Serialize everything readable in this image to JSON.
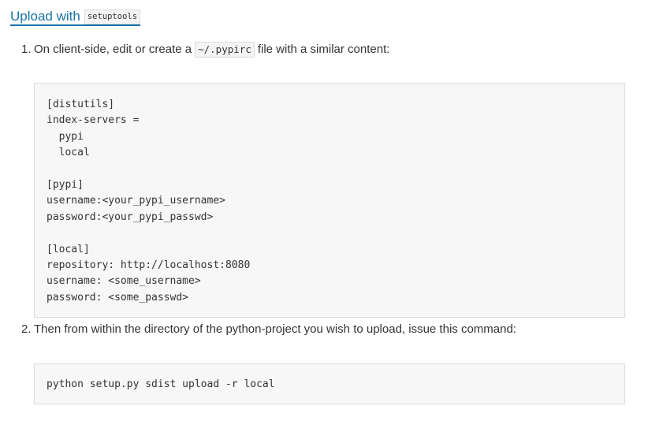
{
  "heading": {
    "link_text": "Upload with",
    "code_text": "setuptools"
  },
  "steps": [
    {
      "number": "1.",
      "text_before": "On client-side, edit or create a",
      "code": "~/.pypirc",
      "text_after": "file with a similar content:"
    },
    {
      "number": "2.",
      "text": "Then from within the directory of the python-project you wish to upload, issue this command:"
    }
  ],
  "code_blocks": {
    "config": "[distutils]\nindex-servers =\n  pypi\n  local\n\n[pypi]\nusername:<your_pypi_username>\npassword:<your_pypi_passwd>\n\n[local]\nrepository: http://localhost:8080\nusername: <some_username>\npassword: <some_passwd>",
    "command": "python setup.py sdist upload -r local"
  }
}
